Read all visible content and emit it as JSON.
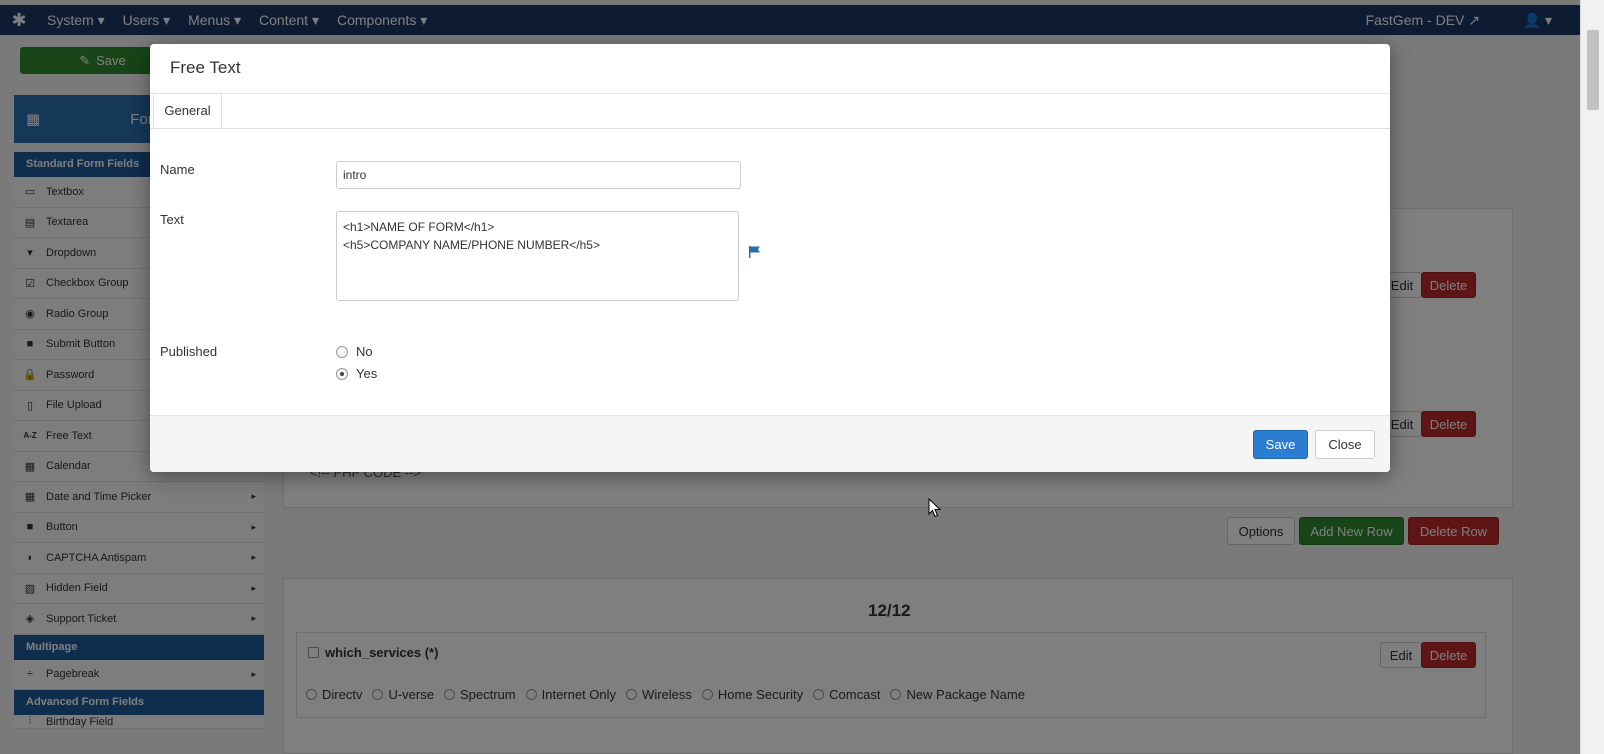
{
  "topbar": {
    "logo_icon": "joomla-icon",
    "menu": [
      "System ▾",
      "Users ▾",
      "Menus ▾",
      "Content ▾",
      "Components ▾"
    ],
    "site_name": "FastGem - DEV",
    "user_menu": "▾"
  },
  "toolbar": {
    "save_label": "Save"
  },
  "forms_box": {
    "label": "Form"
  },
  "sidebar": {
    "standard_heading": "Standard Form Fields",
    "standard_items": [
      {
        "label": "Textbox",
        "icon": "textbox-icon"
      },
      {
        "label": "Textarea",
        "icon": "textarea-icon"
      },
      {
        "label": "Dropdown",
        "icon": "dropdown-icon"
      },
      {
        "label": "Checkbox Group",
        "icon": "checkbox-icon"
      },
      {
        "label": "Radio Group",
        "icon": "radio-icon"
      },
      {
        "label": "Submit Button",
        "icon": "submit-icon"
      },
      {
        "label": "Password",
        "icon": "lock-icon"
      },
      {
        "label": "File Upload",
        "icon": "file-icon"
      },
      {
        "label": "Free Text",
        "icon": "a-z-icon"
      },
      {
        "label": "Calendar",
        "icon": "calendar-icon"
      },
      {
        "label": "Date and Time Picker",
        "icon": "calendar-icon"
      },
      {
        "label": "Button",
        "icon": "button-icon"
      },
      {
        "label": "CAPTCHA Antispam",
        "icon": "shield-icon"
      },
      {
        "label": "Hidden Field",
        "icon": "hidden-icon"
      },
      {
        "label": "Support Ticket",
        "icon": "ticket-icon"
      }
    ],
    "multipage_heading": "Multipage",
    "multipage_items": [
      {
        "label": "Pagebreak",
        "icon": "pagebreak-icon"
      }
    ],
    "advanced_heading": "Advanced Form Fields",
    "advanced_items": [
      {
        "label": "Birthday Field",
        "icon": "birthday-icon"
      }
    ]
  },
  "main": {
    "edit_label": "Edit",
    "delete_label": "Delete",
    "php_code": "<!-- PHP CODE -->",
    "options_label": "Options",
    "add_row_label": "Add New Row",
    "delete_row_label": "Delete Row",
    "row_title": "12/12",
    "services_field": "which_services (*)",
    "services_options": [
      "Directv",
      "U-verse",
      "Spectrum",
      "Internet Only",
      "Wireless",
      "Home Security",
      "Comcast",
      "New Package Name"
    ]
  },
  "modal": {
    "title": "Free Text",
    "tab": "General",
    "name_label": "Name",
    "name_value": "intro",
    "text_label": "Text",
    "text_value": "<h1>NAME OF FORM</h1>\n<h5>COMPANY NAME/PHONE NUMBER</h5>",
    "published_label": "Published",
    "published_options": [
      "No",
      "Yes"
    ],
    "published_selected": "Yes",
    "save_label": "Save",
    "close_label": "Close"
  },
  "colors": {
    "nav": "#1a3867",
    "primary": "#2a7dd0",
    "danger": "#bd2a2a",
    "success": "#2f8a2f"
  }
}
